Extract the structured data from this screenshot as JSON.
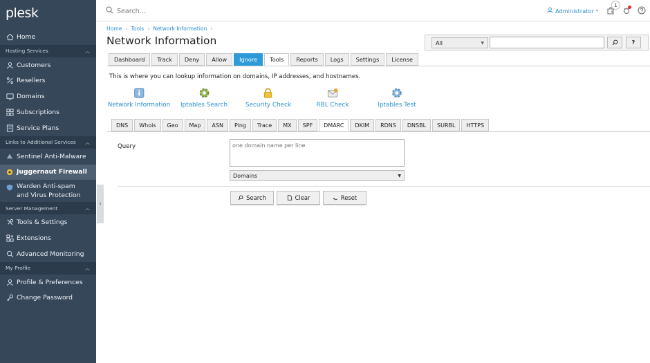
{
  "sidebar": {
    "logo": "plesk",
    "home": "Home",
    "sections": [
      {
        "label": "Hosting Services",
        "items": [
          "Customers",
          "Resellers",
          "Domains",
          "Subscriptions",
          "Service Plans"
        ]
      },
      {
        "label": "Links to Additional Services",
        "items": [
          "Sentinel Anti-Malware",
          "Juggernaut Firewall",
          "Warden Anti-spam and Virus Protection"
        ]
      },
      {
        "label": "Server Management",
        "items": [
          "Tools & Settings",
          "Extensions",
          "Advanced Monitoring"
        ]
      },
      {
        "label": "My Profile",
        "items": [
          "Profile & Preferences",
          "Change Password"
        ]
      }
    ],
    "active_item": "Juggernaut Firewall"
  },
  "topbar": {
    "search_placeholder": "Search...",
    "user": "Administrator",
    "notification_count": "1"
  },
  "breadcrumb": [
    "Home",
    "Tools",
    "Network Information"
  ],
  "page_title": "Network Information",
  "filter": {
    "select_value": "All",
    "search_value": "",
    "help_label": "?"
  },
  "tabs": [
    "Dashboard",
    "Track",
    "Deny",
    "Allow",
    "Ignore",
    "Tools",
    "Reports",
    "Logs",
    "Settings",
    "License"
  ],
  "highlight_tab": "Ignore",
  "selected_tab": "Tools",
  "intro": "This is where you can lookup information on domains, IP addresses, and hostnames.",
  "tools": [
    "Network Information",
    "Iptables Search",
    "Security Check",
    "RBL Check",
    "Iptables Test"
  ],
  "subtabs": [
    "DNS",
    "Whois",
    "Geo",
    "Map",
    "ASN",
    "Ping",
    "Trace",
    "MX",
    "SPF",
    "DMARC",
    "DKIM",
    "RDNS",
    "DNSBL",
    "SURBL",
    "HTTPS"
  ],
  "selected_subtab": "DMARC",
  "form": {
    "query_label": "Query",
    "query_placeholder": "one domain name per line",
    "type_value": "Domains",
    "search_btn": "Search",
    "clear_btn": "Clear",
    "reset_btn": "Reset"
  },
  "colors": {
    "sidebar_bg": "#36475a",
    "accent": "#2a8fd1",
    "highlight_tab": "#2d9bd8"
  }
}
